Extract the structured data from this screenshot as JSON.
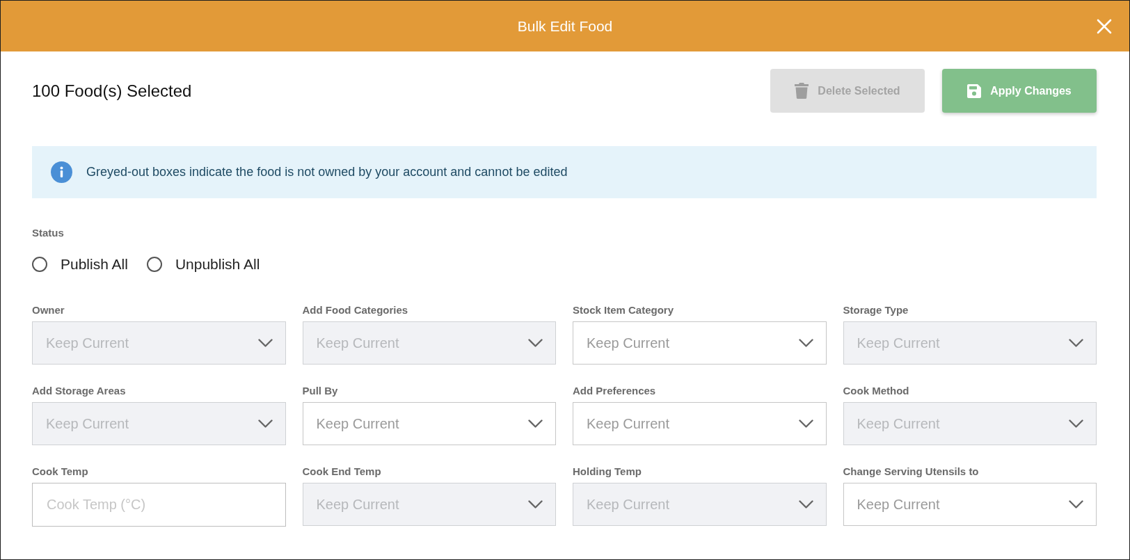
{
  "dialog": {
    "title": "Bulk Edit Food"
  },
  "toolbar": {
    "heading": "100 Food(s) Selected",
    "buttons": [
      {
        "label": "Delete Selected",
        "kind": "delete",
        "disabled": true
      },
      {
        "label": "Apply Changes",
        "kind": "apply",
        "disabled": false
      }
    ]
  },
  "notice": {
    "text": "Greyed-out boxes indicate the food is not owned by your account and cannot be edited"
  },
  "status": {
    "label": "Status",
    "options": [
      {
        "label": "Publish All",
        "selected": false
      },
      {
        "label": "Unpublish All",
        "selected": false
      }
    ]
  },
  "fields": [
    {
      "label": "Owner",
      "kind": "select",
      "placeholder": "Keep Current",
      "disabled": true
    },
    {
      "label": "Add Food Categories",
      "kind": "select",
      "placeholder": "Keep Current",
      "disabled": true
    },
    {
      "label": "Stock Item Category",
      "kind": "select",
      "placeholder": "Keep Current",
      "disabled": false
    },
    {
      "label": "Storage Type",
      "kind": "select",
      "placeholder": "Keep Current",
      "disabled": true
    },
    {
      "label": "Add Storage Areas",
      "kind": "select",
      "placeholder": "Keep Current",
      "disabled": true
    },
    {
      "label": "Pull By",
      "kind": "select",
      "placeholder": "Keep Current",
      "disabled": false
    },
    {
      "label": "Add Preferences",
      "kind": "select",
      "placeholder": "Keep Current",
      "disabled": false
    },
    {
      "label": "Cook Method",
      "kind": "select",
      "placeholder": "Keep Current",
      "disabled": true
    },
    {
      "label": "Cook Temp",
      "kind": "text",
      "placeholder": "Cook Temp (°C)",
      "disabled": false
    },
    {
      "label": "Cook End Temp",
      "kind": "select",
      "placeholder": "Keep Current",
      "disabled": true
    },
    {
      "label": "Holding Temp",
      "kind": "select",
      "placeholder": "Keep Current",
      "disabled": true
    },
    {
      "label": "Change Serving Utensils to",
      "kind": "select",
      "placeholder": "Keep Current",
      "disabled": false
    }
  ]
}
